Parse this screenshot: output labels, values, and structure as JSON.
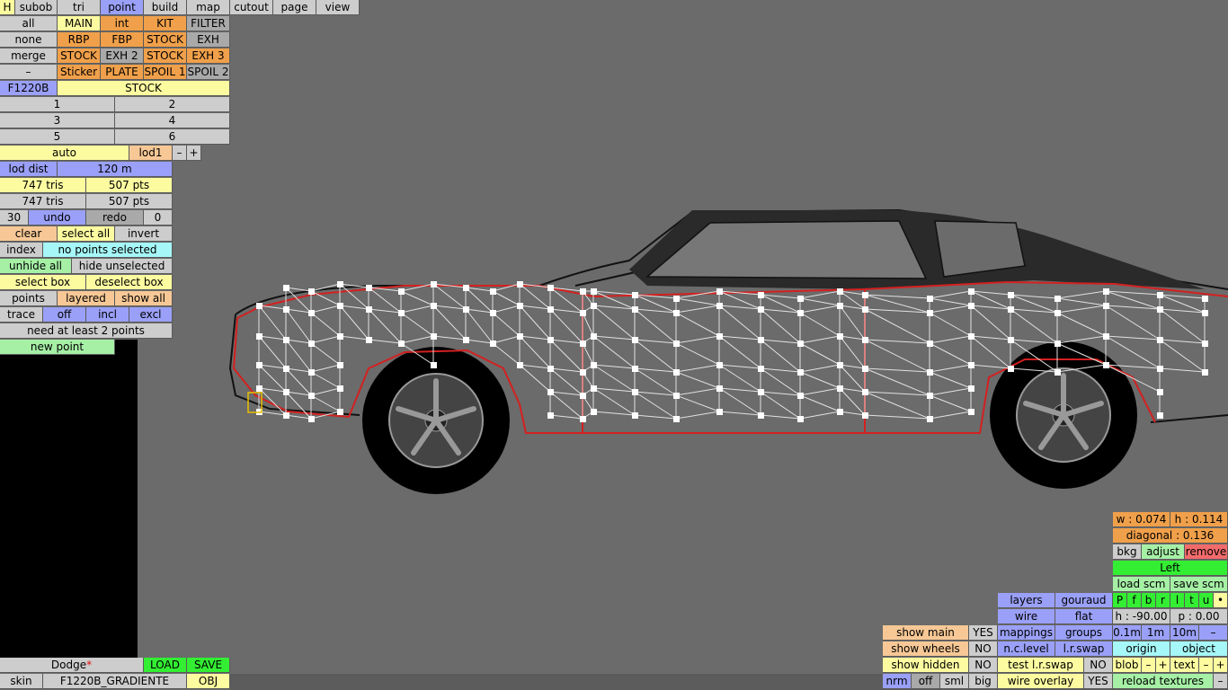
{
  "toolbar": {
    "h": "H",
    "subob": "subob",
    "tri": "tri",
    "point": "point",
    "build": "build",
    "map": "map",
    "cutout": "cutout",
    "page": "page",
    "view": "view"
  },
  "parts": {
    "row1": [
      "all",
      "MAIN",
      "int",
      "KIT",
      "FILTER"
    ],
    "row2": [
      "none",
      "RBP",
      "FBP",
      "STOCK",
      "EXH"
    ],
    "row3": [
      "merge",
      "STOCK",
      "EXH 2",
      "STOCK",
      "EXH 3"
    ],
    "row4": [
      "–",
      "Sticker",
      "PLATE",
      "SPOIL 1",
      "SPOIL 2"
    ]
  },
  "model": {
    "code": "F1220B",
    "variant": "STOCK"
  },
  "lod_slots": [
    "1",
    "2",
    "3",
    "4",
    "5",
    "6"
  ],
  "lod": {
    "auto": "auto",
    "level": "lod1",
    "minus": "–",
    "plus": "+",
    "dist_label": "lod dist",
    "dist_value": "120 m"
  },
  "stats": {
    "tris1": "747 tris",
    "pts1": "507 pts",
    "tris2": "747 tris",
    "pts2": "507 pts"
  },
  "history": {
    "count": "30",
    "undo": "undo",
    "redo": "redo",
    "redo_count": "0"
  },
  "selection": {
    "clear": "clear",
    "select_all": "select all",
    "invert": "invert",
    "index": "index",
    "status": "no points selected",
    "unhide_all": "unhide all",
    "hide_unselected": "hide unselected",
    "select_box": "select box",
    "deselect_box": "deselect box",
    "points": "points",
    "layered": "layered",
    "show_all": "show all",
    "trace": "trace",
    "off": "off",
    "incl": "incl",
    "excl": "excl",
    "need_points": "need at least 2 points",
    "new_point": "new point"
  },
  "file": {
    "name": "Dodge",
    "modified": "*",
    "load": "LOAD",
    "save": "SAVE",
    "skin": "skin",
    "skin_name": "F1220B_GRADIENTE",
    "obj": "OBJ"
  },
  "visibility": {
    "show_main": "show main",
    "show_main_val": "YES",
    "show_wheels": "show wheels",
    "show_wheels_val": "NO",
    "show_hidden": "show hidden",
    "show_hidden_val": "NO",
    "nrm": "nrm",
    "off": "off",
    "sml": "sml",
    "big": "big"
  },
  "render": {
    "layers": "layers",
    "gouraud": "gouraud",
    "wire": "wire",
    "flat": "flat",
    "mappings": "mappings",
    "groups": "groups",
    "nc_level": "n.c.level",
    "lr_swap": "l.r.swap",
    "test_lr_swap": "test l.r.swap",
    "test_lr_swap_val": "NO",
    "wire_overlay": "wire overlay",
    "wire_overlay_val": "YES"
  },
  "background": {
    "w": "w : 0.074",
    "h": "h : 0.114",
    "diagonal": "diagonal : 0.136",
    "bkg": "bkg",
    "adjust": "adjust",
    "remove": "remove",
    "view": "Left",
    "load_scm": "load scm",
    "save_scm": "save scm",
    "flags": [
      "P",
      "f",
      "b",
      "r",
      "l",
      "t",
      "u",
      "•"
    ],
    "heading": "h : -90.00",
    "pitch": "p : 0.00",
    "step1": "0.1m",
    "step2": "1m",
    "step3": "10m",
    "step_minus": "–",
    "origin": "origin",
    "object": "object",
    "blob": "blob",
    "blob_minus": "–",
    "blob_plus": "+",
    "text": "text",
    "text_minus": "–",
    "text_plus": "+",
    "reload": "reload textures",
    "reload_minus": "–"
  },
  "colors": {
    "wire": "#e8e8e8",
    "outline": "#d42020",
    "vertex": "#ffffff",
    "roof": "#222222"
  }
}
